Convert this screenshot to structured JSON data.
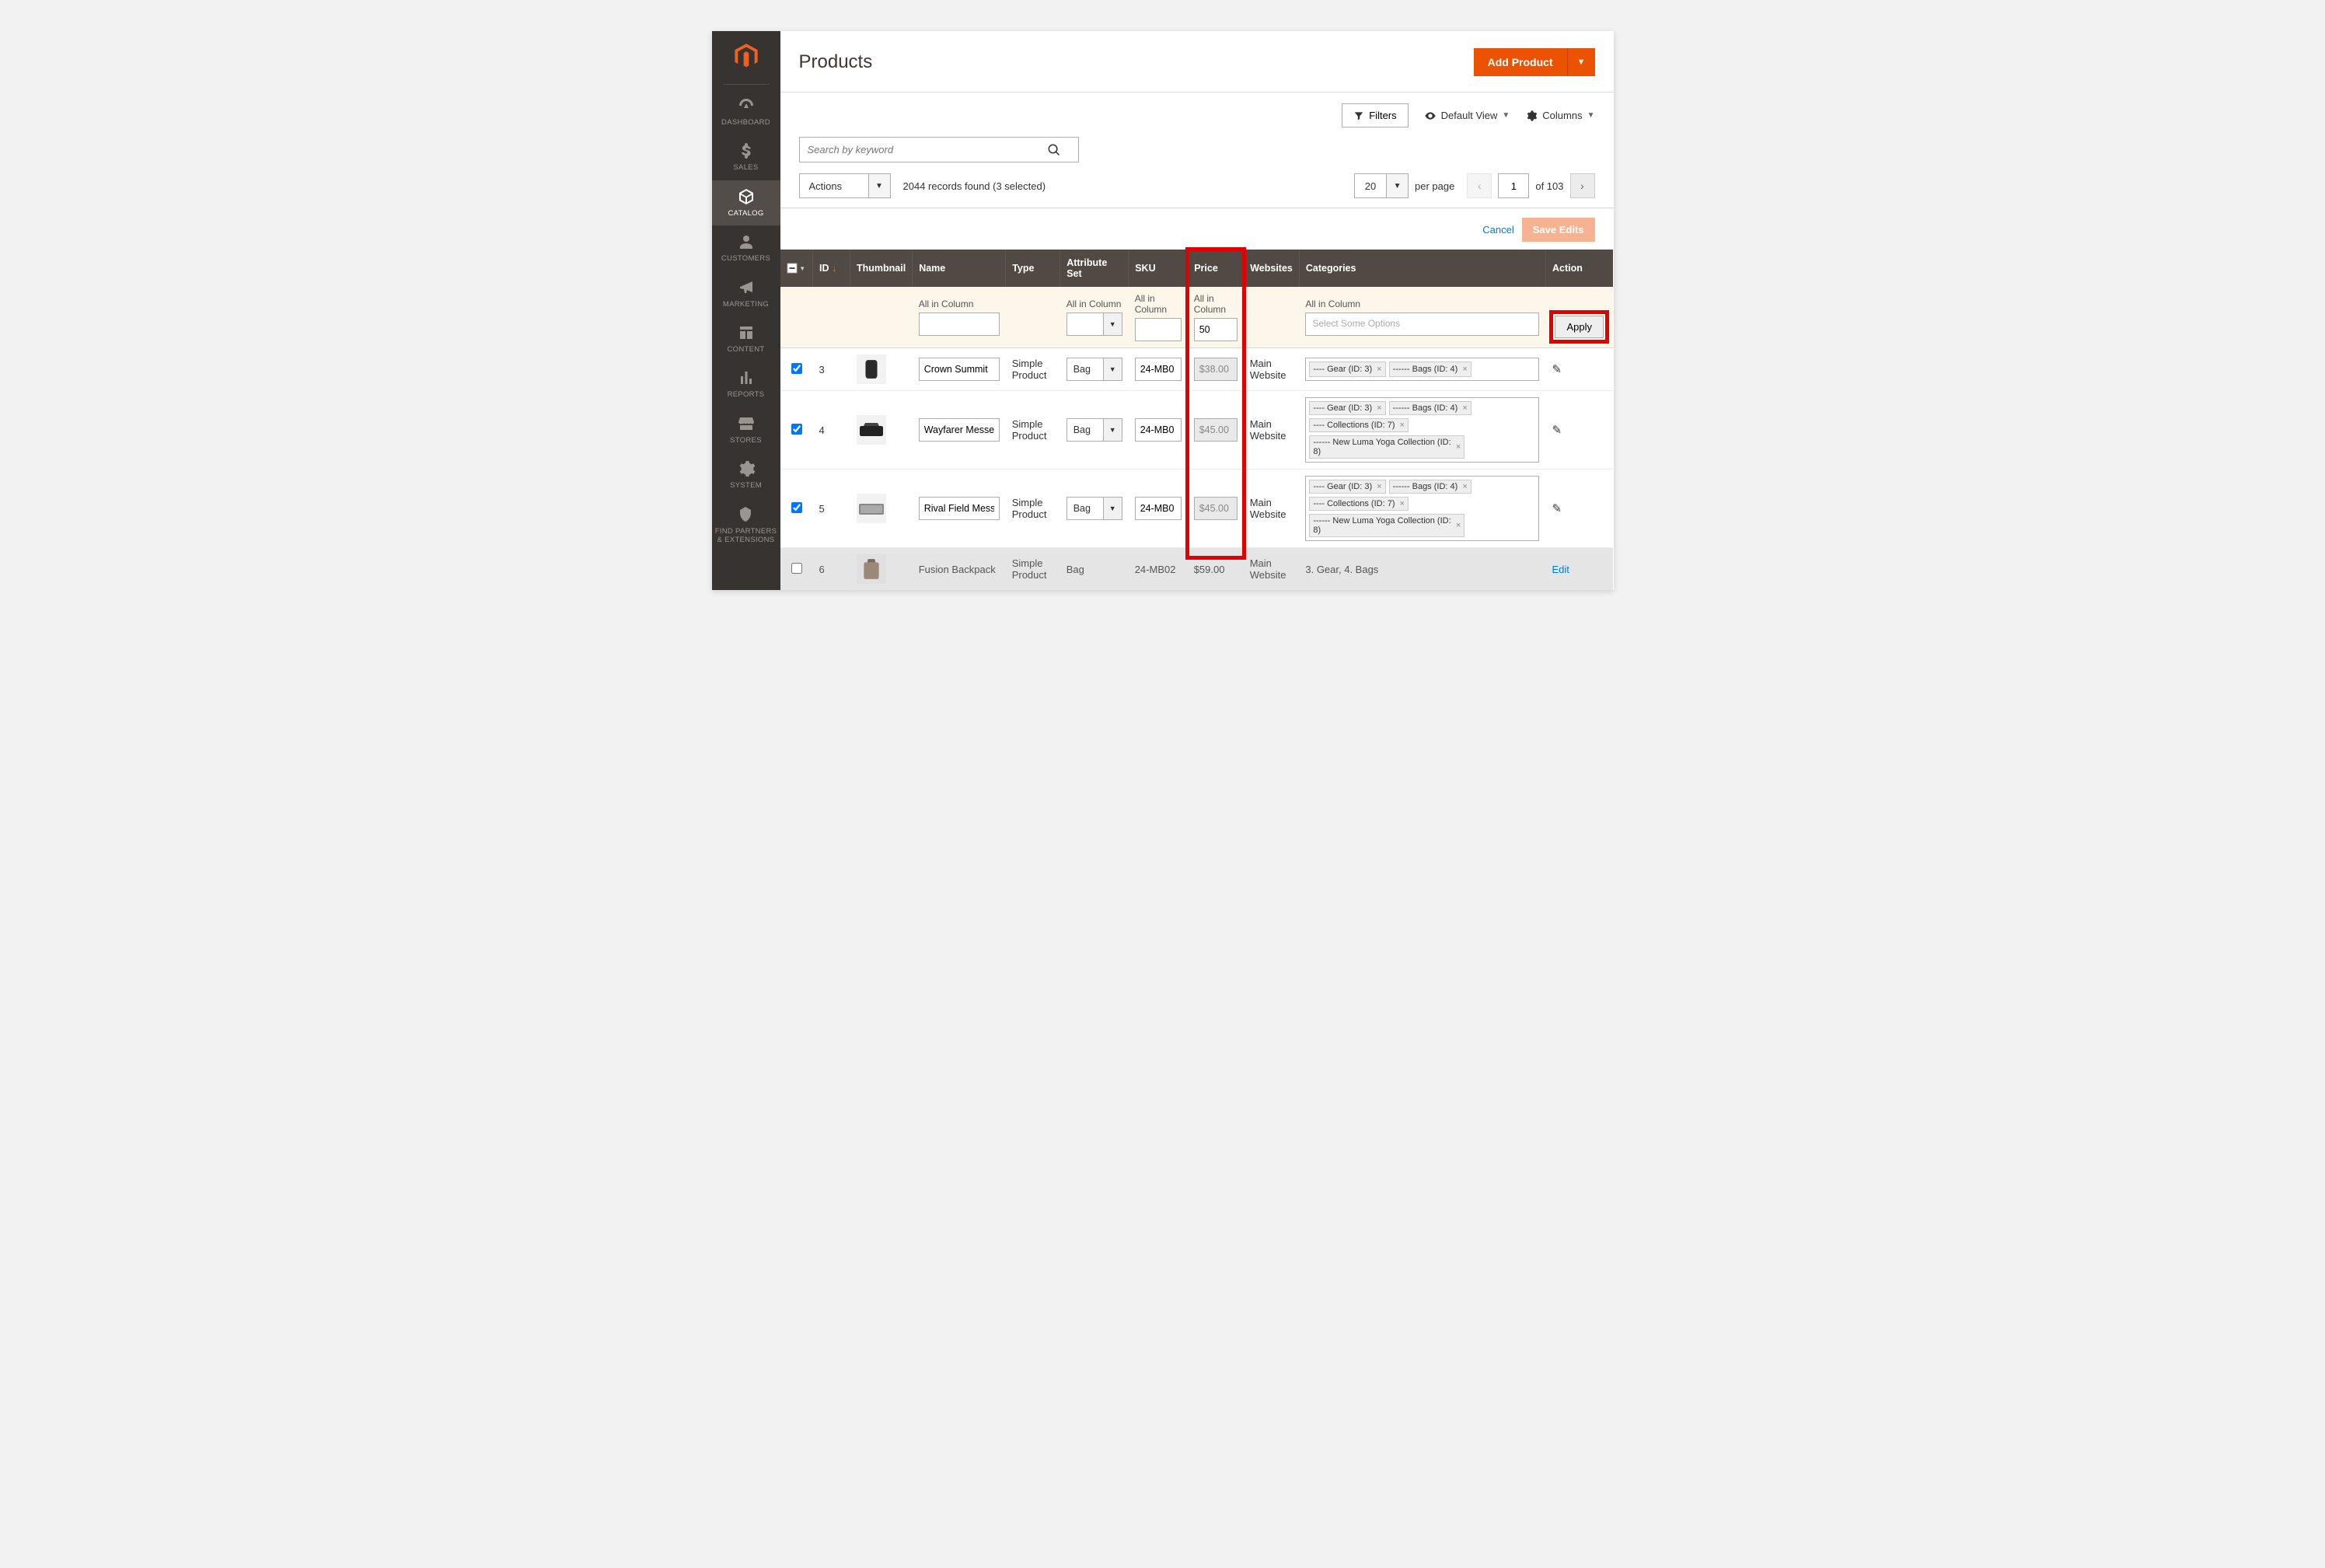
{
  "sidebar": {
    "items": [
      {
        "label": "DASHBOARD"
      },
      {
        "label": "SALES"
      },
      {
        "label": "CATALOG"
      },
      {
        "label": "CUSTOMERS"
      },
      {
        "label": "MARKETING"
      },
      {
        "label": "CONTENT"
      },
      {
        "label": "REPORTS"
      },
      {
        "label": "STORES"
      },
      {
        "label": "SYSTEM"
      },
      {
        "label": "FIND PARTNERS & EXTENSIONS"
      }
    ]
  },
  "page": {
    "title": "Products"
  },
  "buttons": {
    "add_product": "Add Product",
    "filters": "Filters",
    "default_view": "Default View",
    "columns": "Columns",
    "cancel": "Cancel",
    "save_edits": "Save Edits",
    "apply": "Apply"
  },
  "search": {
    "placeholder": "Search by keyword"
  },
  "actions": {
    "label": "Actions"
  },
  "records": {
    "text": "2044 records found (3 selected)"
  },
  "pager": {
    "per_page_value": "20",
    "per_page_label": "per page",
    "page": "1",
    "of": "of 103"
  },
  "columns": {
    "id": "ID",
    "thumbnail": "Thumbnail",
    "name": "Name",
    "type": "Type",
    "attribute_set": "Attribute Set",
    "sku": "SKU",
    "price": "Price",
    "websites": "Websites",
    "categories": "Categories",
    "action": "Action"
  },
  "headerRow": {
    "all_in_column": "All in Column",
    "price_value": "50",
    "categories_placeholder": "Select Some Options"
  },
  "rows": [
    {
      "id": "3",
      "name": "Crown Summit",
      "type": "Simple Product",
      "attr": "Bag",
      "sku": "24-MB0",
      "price": "$38.00",
      "website": "Main Website",
      "categories": [
        "---- Gear (ID: 3)",
        "------ Bags (ID: 4)"
      ]
    },
    {
      "id": "4",
      "name": "Wayfarer Messe",
      "type": "Simple Product",
      "attr": "Bag",
      "sku": "24-MB0",
      "price": "$45.00",
      "website": "Main Website",
      "categories": [
        "---- Gear (ID: 3)",
        "------ Bags (ID: 4)",
        "---- Collections (ID: 7)",
        "------ New Luma Yoga Collection (ID: 8)"
      ]
    },
    {
      "id": "5",
      "name": "Rival Field Mess",
      "type": "Simple Product",
      "attr": "Bag",
      "sku": "24-MB0",
      "price": "$45.00",
      "website": "Main Website",
      "categories": [
        "---- Gear (ID: 3)",
        "------ Bags (ID: 4)",
        "---- Collections (ID: 7)",
        "------ New Luma Yoga Collection (ID: 8)"
      ]
    }
  ],
  "lockedRow": {
    "id": "6",
    "name": "Fusion Backpack",
    "type": "Simple Product",
    "attr": "Bag",
    "sku": "24-MB02",
    "price": "$59.00",
    "website": "Main Website",
    "categories": "3. Gear, 4. Bags",
    "edit": "Edit"
  }
}
